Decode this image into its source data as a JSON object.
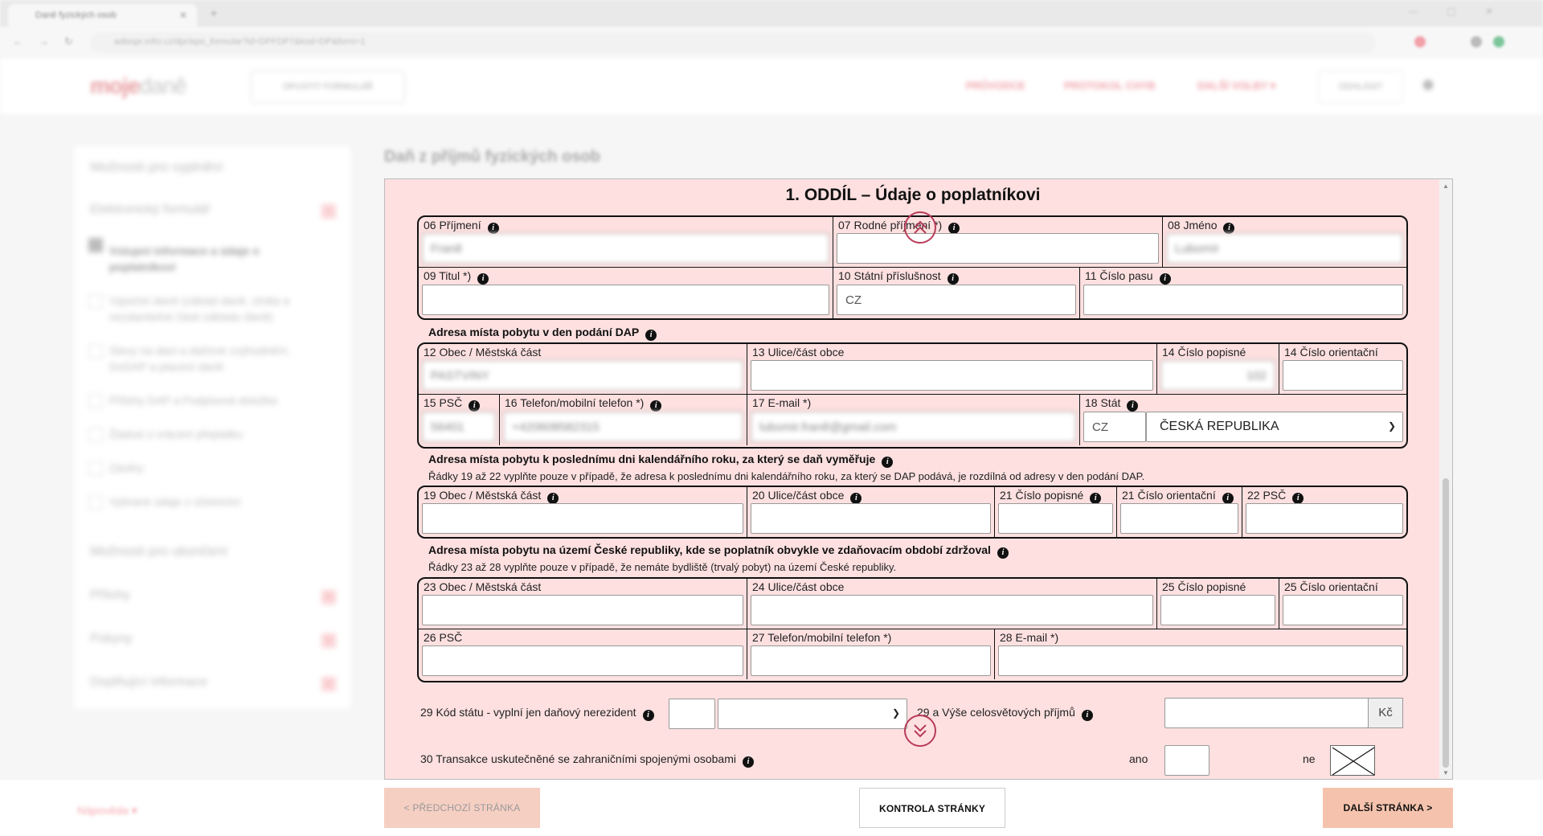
{
  "browser": {
    "tab_title": "Daně fyzických osob",
    "url": "adisspr.mfcr.cz/dpr/epo_formular?id=DPFDP7&kod=DP&form=1"
  },
  "header": {
    "logo_part1": "moje",
    "logo_part2": "daně",
    "fill_button": "OPUSTIT FORMULÁŘ",
    "nav": [
      "PRŮVODCE",
      "PROTOKOL CHYB",
      "DALŠÍ VOLBY ▾"
    ],
    "logout": "ODHLÁSIT"
  },
  "sidebar": {
    "section1": "Možnosti pro vyplnění",
    "electronic_form": "Elektronický formulář",
    "items": [
      "Vstupní informace a údaje o poplatníkovi",
      "Výpočet daně (základ daně, ztráta a nezdanitelné části základu daně)",
      "Slevy na dani a daňové zvýhodnění, DoDAP a placení daně",
      "Přílohy DAP a Podpisová doložka",
      "Žádost o vrácení přeplatku",
      "Závěry",
      "Vybrané údaje z účetnictví"
    ],
    "section2": "Možnosti pro ukončení",
    "links": [
      "Přílohy",
      "Pokyny",
      "Doplňující informace"
    ]
  },
  "page_title": "Daň z příjmů fyzických osob",
  "form": {
    "section_title": "1. ODDÍL – Údaje o poplatníkovi",
    "f06_label": "06 Příjmení",
    "f06_value": "Franě",
    "f07_label": "07 Rodné příjmení *)",
    "f07_value": "",
    "f08_label": "08 Jméno",
    "f08_value": "Lubomír",
    "f09_label": "09 Titul *)",
    "f10_label": "10 Státní příslušnost",
    "f10_value": "CZ",
    "f11_label": "11 Číslo pasu",
    "addr1_head": "Adresa místa pobytu v den podání DAP",
    "f12_label": "12 Obec / Městská část",
    "f12_value": "PASTVINY",
    "f13_label": "13 Ulice/část obce",
    "f14a_label": "14 Číslo popisné",
    "f14a_value": "102",
    "f14b_label": "14 Číslo orientační",
    "f15_label": "15 PSČ",
    "f15_value": "56401",
    "f16_label": "16 Telefon/mobilní telefon *)",
    "f16_value": "+420608582315",
    "f17_label": "17 E-mail *)",
    "f17_value": "lubomir.franě@gmail.com",
    "f18_label": "18 Stát",
    "f18_code": "CZ",
    "f18_country": "ČESKÁ REPUBLIKA",
    "addr2_head": "Adresa místa pobytu k poslednímu dni kalendářního roku, za který se daň vyměřuje",
    "addr2_note": "Řádky 19 až 22 vyplňte pouze v případě, že adresa k poslednímu dni kalendářního roku, za který se DAP podává, je rozdílná od adresy v den podání DAP.",
    "f19_label": "19 Obec / Městská část",
    "f20_label": "20 Ulice/část obce",
    "f21a_label": "21 Číslo popisné",
    "f21b_label": "21 Číslo orientační",
    "f22_label": "22 PSČ",
    "addr3_head": "Adresa místa pobytu na území České republiky, kde se poplatník obvykle ve zdaňovacím období zdržoval",
    "addr3_note": "Řádky 23 až 28 vyplňte pouze v případě, že nemáte bydliště (trvalý pobyt) na území České republiky.",
    "f23_label": "23 Obec / Městská část",
    "f24_label": "24 Ulice/část obce",
    "f25a_label": "25 Číslo popisné",
    "f25b_label": "25 Číslo orientační",
    "f26_label": "26 PSČ",
    "f27_label": "27 Telefon/mobilní telefon *)",
    "f28_label": "28 E-mail *)",
    "f29_label": "29 Kód státu - vyplní jen daňový nerezident",
    "f29a_label": "29 a Výše celosvětových příjmů",
    "currency": "Kč",
    "f30_label": "30 Transakce uskutečněné se zahraničními spojenými osobami",
    "yes": "ano",
    "no": "ne"
  },
  "footer": {
    "helper": "Nápověda ▾",
    "prev": "< PŘEDCHOZÍ STRÁNKA",
    "check": "KONTROLA STRÁNKY",
    "next": "DALŠÍ STRÁNKA >"
  },
  "colors": {
    "form_bg": "#fee0e0",
    "accent": "#b73a57",
    "next_btn": "#f5c3ad"
  },
  "icons": [
    "info-icon",
    "chevron-down-icon",
    "double-chevron-up-icon",
    "double-chevron-down-icon",
    "close-icon",
    "user-icon",
    "checkbox-x-icon"
  ]
}
